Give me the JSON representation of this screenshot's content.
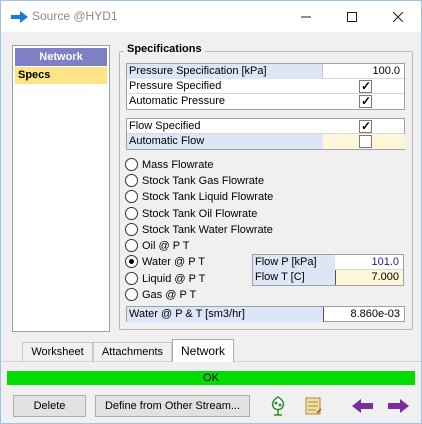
{
  "window": {
    "title": "Source @HYD1"
  },
  "nav": {
    "header": "Network",
    "items": [
      "Specs"
    ]
  },
  "specs": {
    "group_title": "Specifications",
    "pressure_spec_label": "Pressure Specification [kPa]",
    "pressure_spec_value": "100.0",
    "pressure_specified_label": "Pressure Specified",
    "pressure_specified_checked": true,
    "auto_pressure_label": "Automatic Pressure",
    "auto_pressure_checked": true,
    "flow_specified_label": "Flow Specified",
    "flow_specified_checked": true,
    "auto_flow_label": "Automatic Flow",
    "auto_flow_checked": false
  },
  "flow_options": {
    "selected": "Water @ P  T",
    "options": [
      "Mass  Flowrate",
      "Stock Tank Gas Flowrate",
      "Stock Tank Liquid Flowrate",
      "Stock Tank Oil Flowrate",
      "Stock Tank Water Flowrate",
      "Oil @ P  T",
      "Water @ P  T",
      "Liquid @ P  T",
      "Gas @ P  T"
    ]
  },
  "flow_conditions": {
    "flow_p_label": "Flow P [kPa]",
    "flow_p_value": "101.0",
    "flow_t_label": "Flow T [C]",
    "flow_t_value": "7.000"
  },
  "water_rate": {
    "label": "Water @ P & T [sm3/hr]",
    "value": "8.860e-03"
  },
  "tabs": [
    "Worksheet",
    "Attachments",
    "Network"
  ],
  "active_tab": "Network",
  "status": {
    "text": "OK",
    "color": "#00dc00"
  },
  "buttons": {
    "delete": "Delete",
    "define": "Define from Other Stream..."
  },
  "icons": [
    "stream-properties-icon",
    "notes-icon",
    "previous-arrow-icon",
    "next-arrow-icon"
  ],
  "colors": {
    "nav_header": "#7f7fc5",
    "selected_item": "#ffe486",
    "label_blue": "#dce6f7",
    "input_yellow": "#fdf6d8",
    "arrow_purple": "#7a2f98"
  }
}
